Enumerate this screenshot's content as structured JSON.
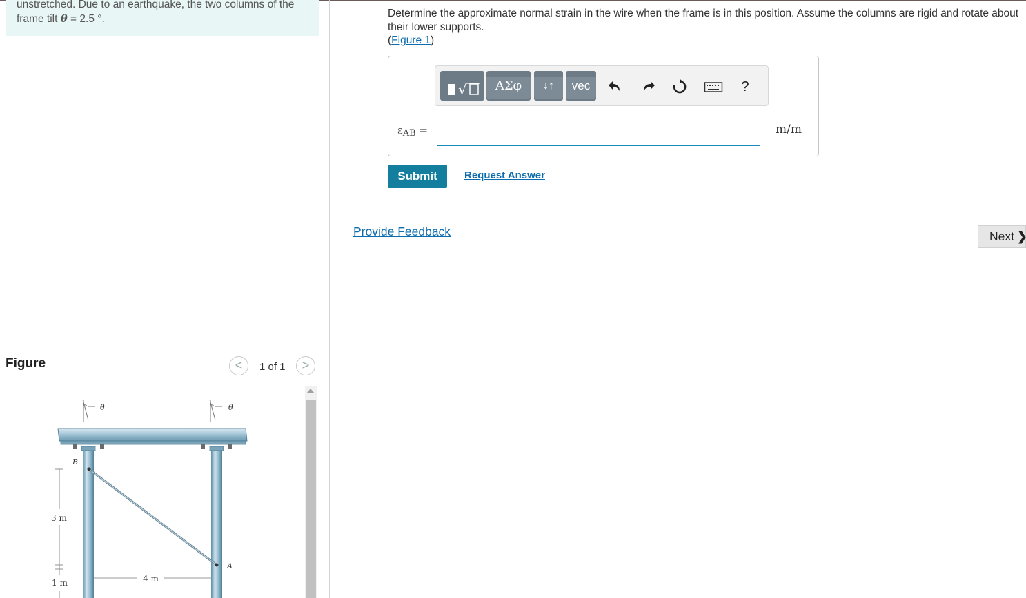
{
  "problem": {
    "text_before": "unstretched. Due to an earthquake, the two columns of the frame tilt ",
    "theta_symbol": "θ",
    "text_after": " = 2.5 °."
  },
  "figure_panel": {
    "title": "Figure",
    "pager_text": "1 of 1",
    "prev_glyph": "<",
    "next_glyph": ">",
    "diagram_labels": {
      "theta_left": "θ",
      "theta_right": "θ",
      "point_b": "B",
      "point_a": "A",
      "height_3m": "3 m",
      "height_1m": "1 m",
      "width_4m": "4 m"
    }
  },
  "question": {
    "text": "Determine the approximate normal strain in the wire when the frame is in this position. Assume the columns are rigid and rotate about their lower supports.",
    "figure_link_open": "(",
    "figure_link": "Figure 1",
    "figure_link_close": ")"
  },
  "toolbar": {
    "templates_icon": "fraction-sqrt-icon",
    "greek_label": "ΑΣφ",
    "arrows_label": "↓↑",
    "vec_label": "vec",
    "undo_icon": "undo-icon",
    "redo_icon": "redo-icon",
    "reset_icon": "reset-icon",
    "keyboard_icon": "keyboard-icon",
    "help_label": "?"
  },
  "answer": {
    "label_symbol": "ε",
    "label_subscript": "AB",
    "label_equals": " =",
    "value": "",
    "unit": "m/m"
  },
  "actions": {
    "submit_label": "Submit",
    "request_label": "Request Answer",
    "feedback_label": "Provide Feedback",
    "next_label": "Next",
    "next_glyph": "❯"
  },
  "colors": {
    "accent": "#147e9e",
    "link": "#0c6cad",
    "problem_bg": "#e9f6f6",
    "toolbar_button": "#6d7b87",
    "input_border": "#1a8cb8"
  }
}
